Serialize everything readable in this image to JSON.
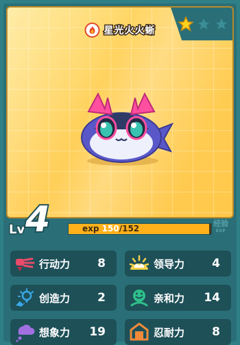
{
  "pet": {
    "name": "星光火火蜥",
    "stars_filled": 1,
    "stars_total": 3
  },
  "level": {
    "label": "Lv",
    "value": "4"
  },
  "exp": {
    "label": "exp",
    "current": "150",
    "max": "152",
    "fill_ratio": 0.987,
    "side_label": "经验",
    "side_sub": "EXP"
  },
  "stats": [
    {
      "label": "行动力",
      "value": "8",
      "icon": "speed-icon"
    },
    {
      "label": "领导力",
      "value": "4",
      "icon": "leadership-icon"
    },
    {
      "label": "创造力",
      "value": "2",
      "icon": "creativity-icon"
    },
    {
      "label": "亲和力",
      "value": "14",
      "icon": "affinity-icon"
    },
    {
      "label": "想象力",
      "value": "19",
      "icon": "imagination-icon"
    },
    {
      "label": "忍耐力",
      "value": "8",
      "icon": "endurance-icon"
    }
  ],
  "colors": {
    "frame": "#2a6f77",
    "stat_panel": "#1e5058",
    "exp_fill": "#ffb11c",
    "hero_bg": "#ffd05a",
    "star_filled": "#ffd21e",
    "star_empty": "#3c8f98"
  }
}
